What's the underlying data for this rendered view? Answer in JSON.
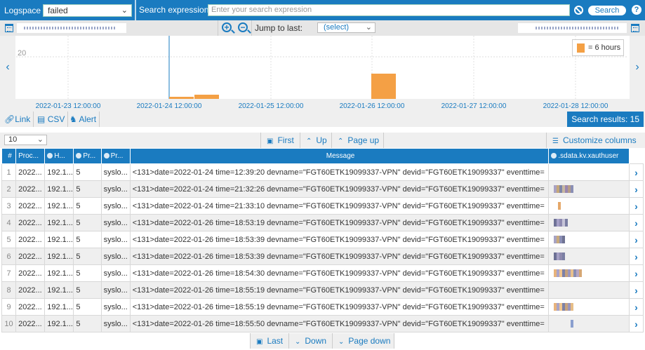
{
  "search": {
    "logspace_label": "Logspace",
    "logspace_value": "failed",
    "expression_label": "Search expression",
    "expression_placeholder": "Enter your search expression",
    "search_button": "Search"
  },
  "timebar": {
    "jump_label": "Jump to last:",
    "jump_value": "(select)"
  },
  "chart_data": {
    "type": "bar",
    "y_tick": "20",
    "x_ticks": [
      "2022-01-23 12:00:00",
      "2022-01-24 12:00:00",
      "2022-01-25 12:00:00",
      "2022-01-26 12:00:00",
      "2022-01-27 12:00:00",
      "2022-01-28 12:00:00"
    ],
    "legend": "= 6 hours",
    "bar_color": "#f4a045",
    "bars": [
      {
        "x": "2022-01-24 12:00",
        "value": 1
      },
      {
        "x": "2022-01-24 18:00",
        "value": 2
      },
      {
        "x": "2022-01-26 12:00",
        "value": 12
      }
    ]
  },
  "actions": {
    "link": "Link",
    "csv": "CSV",
    "alert": "Alert",
    "results": "Search results: 15"
  },
  "pager": {
    "page_size": "10",
    "first": "First",
    "up": "Up",
    "page_up": "Page up",
    "customize": "Customize columns",
    "last": "Last",
    "down": "Down",
    "page_down": "Page down"
  },
  "table": {
    "headers": [
      "#",
      "Proc...",
      "H...",
      "Pr...",
      "Pr...",
      "Message",
      ".sdata.kv.xauthuser"
    ],
    "rows": [
      {
        "n": "1",
        "proc": "2022...",
        "host": "192.1...",
        "pr1": "5",
        "pr2": "syslo...",
        "msg": "<131>date=2022-01-24 time=12:39:20 devname=\"FGT60ETK19099337-VPN\" devid=\"FGT60ETK19099337\" eventtime=",
        "bars": []
      },
      {
        "n": "2",
        "proc": "2022...",
        "host": "192.1...",
        "pr1": "5",
        "pr2": "syslo...",
        "msg": "<131>date=2022-01-24 time=21:32:26 devname=\"FGT60ETK19099337-VPN\" devid=\"FGT60ETK19099337\" eventtime=",
        "bars": [
          "#a9a2c4",
          "#c4a77a",
          "#7f86a8",
          "#c8b7a0",
          "#9a86b0",
          "#b69c86",
          "#8a8fb5"
        ]
      },
      {
        "n": "3",
        "proc": "2022...",
        "host": "192.1...",
        "pr1": "5",
        "pr2": "syslo...",
        "msg": "<131>date=2022-01-24 time=21:33:10 devname=\"FGT60ETK19099337-VPN\" devid=\"FGT60ETK19099337\" eventtime=",
        "bars": [
          "#e5a86a"
        ]
      },
      {
        "n": "4",
        "proc": "2022...",
        "host": "192.1...",
        "pr1": "5",
        "pr2": "syslo...",
        "msg": "<131>date=2022-01-26 time=18:53:19 devname=\"FGT60ETK19099337-VPN\" devid=\"FGT60ETK19099337\" eventtime=",
        "bars": [
          "#6e7296",
          "#a5a0c7",
          "#8e8ab0",
          "#c6c4d8",
          "#7a7ea2"
        ]
      },
      {
        "n": "5",
        "proc": "2022...",
        "host": "192.1...",
        "pr1": "5",
        "pr2": "syslo...",
        "msg": "<131>date=2022-01-26 time=18:53:39 devname=\"FGT60ETK19099337-VPN\" devid=\"FGT60ETK19099337\" eventtime=",
        "bars": [
          "#a7a3c3",
          "#c7aa7e",
          "#8c8fb6",
          "#6f7393"
        ]
      },
      {
        "n": "6",
        "proc": "2022...",
        "host": "192.1...",
        "pr1": "5",
        "pr2": "syslo...",
        "msg": "<131>date=2022-01-26 time=18:53:39 devname=\"FGT60ETK19099337-VPN\" devid=\"FGT60ETK19099337\" eventtime=",
        "bars": [
          "#6c7094",
          "#a5a0c4",
          "#8d89ae",
          "#7b7fa3"
        ]
      },
      {
        "n": "7",
        "proc": "2022...",
        "host": "192.1...",
        "pr1": "5",
        "pr2": "syslo...",
        "msg": "<131>date=2022-01-26 time=18:54:30 devname=\"FGT60ETK19099337-VPN\" devid=\"FGT60ETK19099337\" eventtime=",
        "bars": [
          "#e7b27a",
          "#a9a3c8",
          "#f0c48e",
          "#7c80a8",
          "#c4a07c",
          "#9d96bc",
          "#e8c08c",
          "#8a8db2",
          "#b7a6c2",
          "#d6a774"
        ]
      },
      {
        "n": "8",
        "proc": "2022...",
        "host": "192.1...",
        "pr1": "5",
        "pr2": "syslo...",
        "msg": "<131>date=2022-01-26 time=18:55:19 devname=\"FGT60ETK19099337-VPN\" devid=\"FGT60ETK19099337\" eventtime=",
        "bars": []
      },
      {
        "n": "9",
        "proc": "2022...",
        "host": "192.1...",
        "pr1": "5",
        "pr2": "syslo...",
        "msg": "<131>date=2022-01-26 time=18:55:19 devname=\"FGT60ETK19099337-VPN\" devid=\"FGT60ETK19099337\" eventtime=",
        "bars": [
          "#e8b37c",
          "#a9a4c6",
          "#f1c68f",
          "#7d81a6",
          "#c6a27e",
          "#9b95bb",
          "#e6bd87"
        ]
      },
      {
        "n": "10",
        "proc": "2022...",
        "host": "192.1...",
        "pr1": "5",
        "pr2": "syslo...",
        "msg": "<131>date=2022-01-26 time=18:55:50 devname=\"FGT60ETK19099337-VPN\" devid=\"FGT60ETK19099337\" eventtime=",
        "bars": [
          "#8a9fcf"
        ]
      }
    ]
  }
}
